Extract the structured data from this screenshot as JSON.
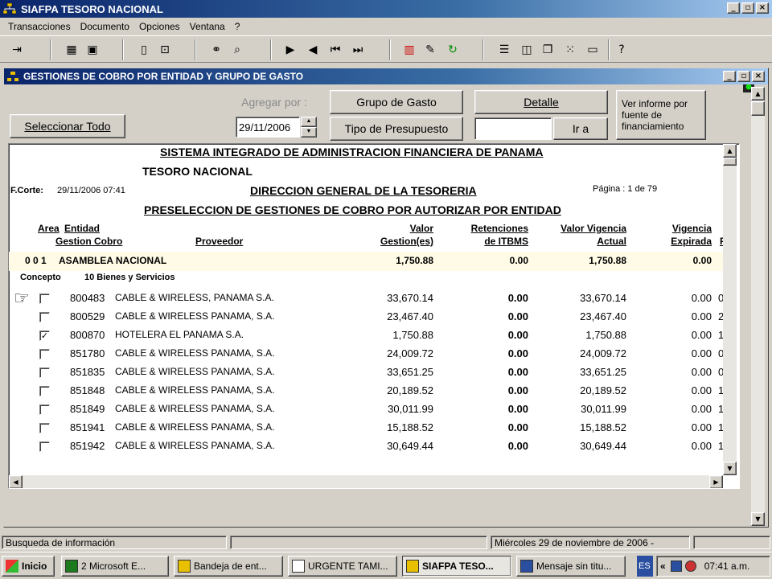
{
  "app": {
    "title": "SIAFPA TESORO NACIONAL"
  },
  "menu": [
    "Transacciones",
    "Documento",
    "Opciones",
    "Ventana",
    "?"
  ],
  "window_controls": {
    "min": "_",
    "max": "▫",
    "close": "×"
  },
  "child": {
    "title": "GESTIONES DE COBRO POR ENTIDAD Y GRUPO DE GASTO"
  },
  "controls": {
    "seleccionar": "Seleccionar Todo",
    "agregar_por": "Agregar por :",
    "date": "29/11/2006",
    "grupo": "Grupo de Gasto",
    "tipo": "Tipo de Presupuesto",
    "detalle": "Detalle",
    "ir_a": "Ir a",
    "ir_value": "",
    "ver_informe": "Ver informe por fuente de financiamiento"
  },
  "report": {
    "title1": "SISTEMA INTEGRADO DE ADMINISTRACION FINANCIERA DE PANAMA",
    "title2": "TESORO NACIONAL",
    "fcorte_label": "F.Corte:",
    "fcorte_value": "29/11/2006 07:41",
    "title3": "DIRECCION GENERAL DE LA TESORERIA",
    "pagina": "Página : 1 de  79",
    "title4": "PRESELECCION DE GESTIONES DE COBRO POR AUTORIZAR POR ENTIDAD",
    "headers": {
      "area": "Area",
      "entidad": "Entidad",
      "gestion": "Gestion Cobro",
      "proveedor": "Proveedor",
      "valor1": "Valor",
      "valor2": "Gestion(es)",
      "ret1": "Retenciones",
      "ret2": "de ITBMS",
      "vv1": "Valor Vigencia",
      "vv2": "Actual",
      "vig1": "Vigencia",
      "vig2": "Expirada",
      "extra": "F"
    },
    "entity": {
      "code": "0 0 1",
      "name": "ASAMBLEA NACIONAL",
      "valor": "1,750.88",
      "ret": "0.00",
      "vv": "1,750.88",
      "vig": "0.00"
    },
    "concepto_label": "Concepto",
    "concepto_value": "10 Bienes y Servicios",
    "rows": [
      {
        "checked": "",
        "code": "800483",
        "prov": "CABLE & WIRELESS, PANAMA S.A.",
        "valor": "33,670.14",
        "ret": "0.00",
        "vv": "33,670.14",
        "vig": "0.00",
        "x": "0"
      },
      {
        "checked": "",
        "code": "800529",
        "prov": "CABLE & WIRELESS PANAMA, S.A.",
        "valor": "23,467.40",
        "ret": "0.00",
        "vv": "23,467.40",
        "vig": "0.00",
        "x": "2"
      },
      {
        "checked": "✓",
        "code": "800870",
        "prov": "HOTELERA EL PANAMA S.A.",
        "valor": "1,750.88",
        "ret": "0.00",
        "vv": "1,750.88",
        "vig": "0.00",
        "x": "1"
      },
      {
        "checked": "",
        "code": "851780",
        "prov": "CABLE & WIRELESS PANAMA, S.A.",
        "valor": "24,009.72",
        "ret": "0.00",
        "vv": "24,009.72",
        "vig": "0.00",
        "x": "0"
      },
      {
        "checked": "",
        "code": "851835",
        "prov": "CABLE & WIRELESS PANAMA, S.A.",
        "valor": "33,651.25",
        "ret": "0.00",
        "vv": "33,651.25",
        "vig": "0.00",
        "x": "0"
      },
      {
        "checked": "",
        "code": "851848",
        "prov": "CABLE & WIRELESS PANAMA, S.A.",
        "valor": "20,189.52",
        "ret": "0.00",
        "vv": "20,189.52",
        "vig": "0.00",
        "x": "1"
      },
      {
        "checked": "",
        "code": "851849",
        "prov": "CABLE & WIRELESS PANAMA, S.A.",
        "valor": "30,011.99",
        "ret": "0.00",
        "vv": "30,011.99",
        "vig": "0.00",
        "x": "1"
      },
      {
        "checked": "",
        "code": "851941",
        "prov": "CABLE & WIRELESS PANAMA, S.A.",
        "valor": "15,188.52",
        "ret": "0.00",
        "vv": "15,188.52",
        "vig": "0.00",
        "x": "1"
      },
      {
        "checked": "",
        "code": "851942",
        "prov": "CABLE & WIRELESS PANAMA, S.A.",
        "valor": "30,649.44",
        "ret": "0.00",
        "vv": "30,649.44",
        "vig": "0.00",
        "x": "1"
      }
    ]
  },
  "status": {
    "left": "Busqueda de información",
    "mid": "",
    "right": "Miércoles 29 de noviembre de 2006 -"
  },
  "taskbar": {
    "start": "Inicio",
    "tasks": [
      "2 Microsoft E...",
      "Bandeja de ent...",
      "URGENTE TAMI...",
      "SIAFPA TESO...",
      "Mensaje sin titu..."
    ],
    "lang": "ES",
    "chev": "«",
    "time": "07:41 a.m."
  },
  "colors": {
    "title_blue": "#0a246a",
    "row_highlight": "#fffbe6"
  }
}
